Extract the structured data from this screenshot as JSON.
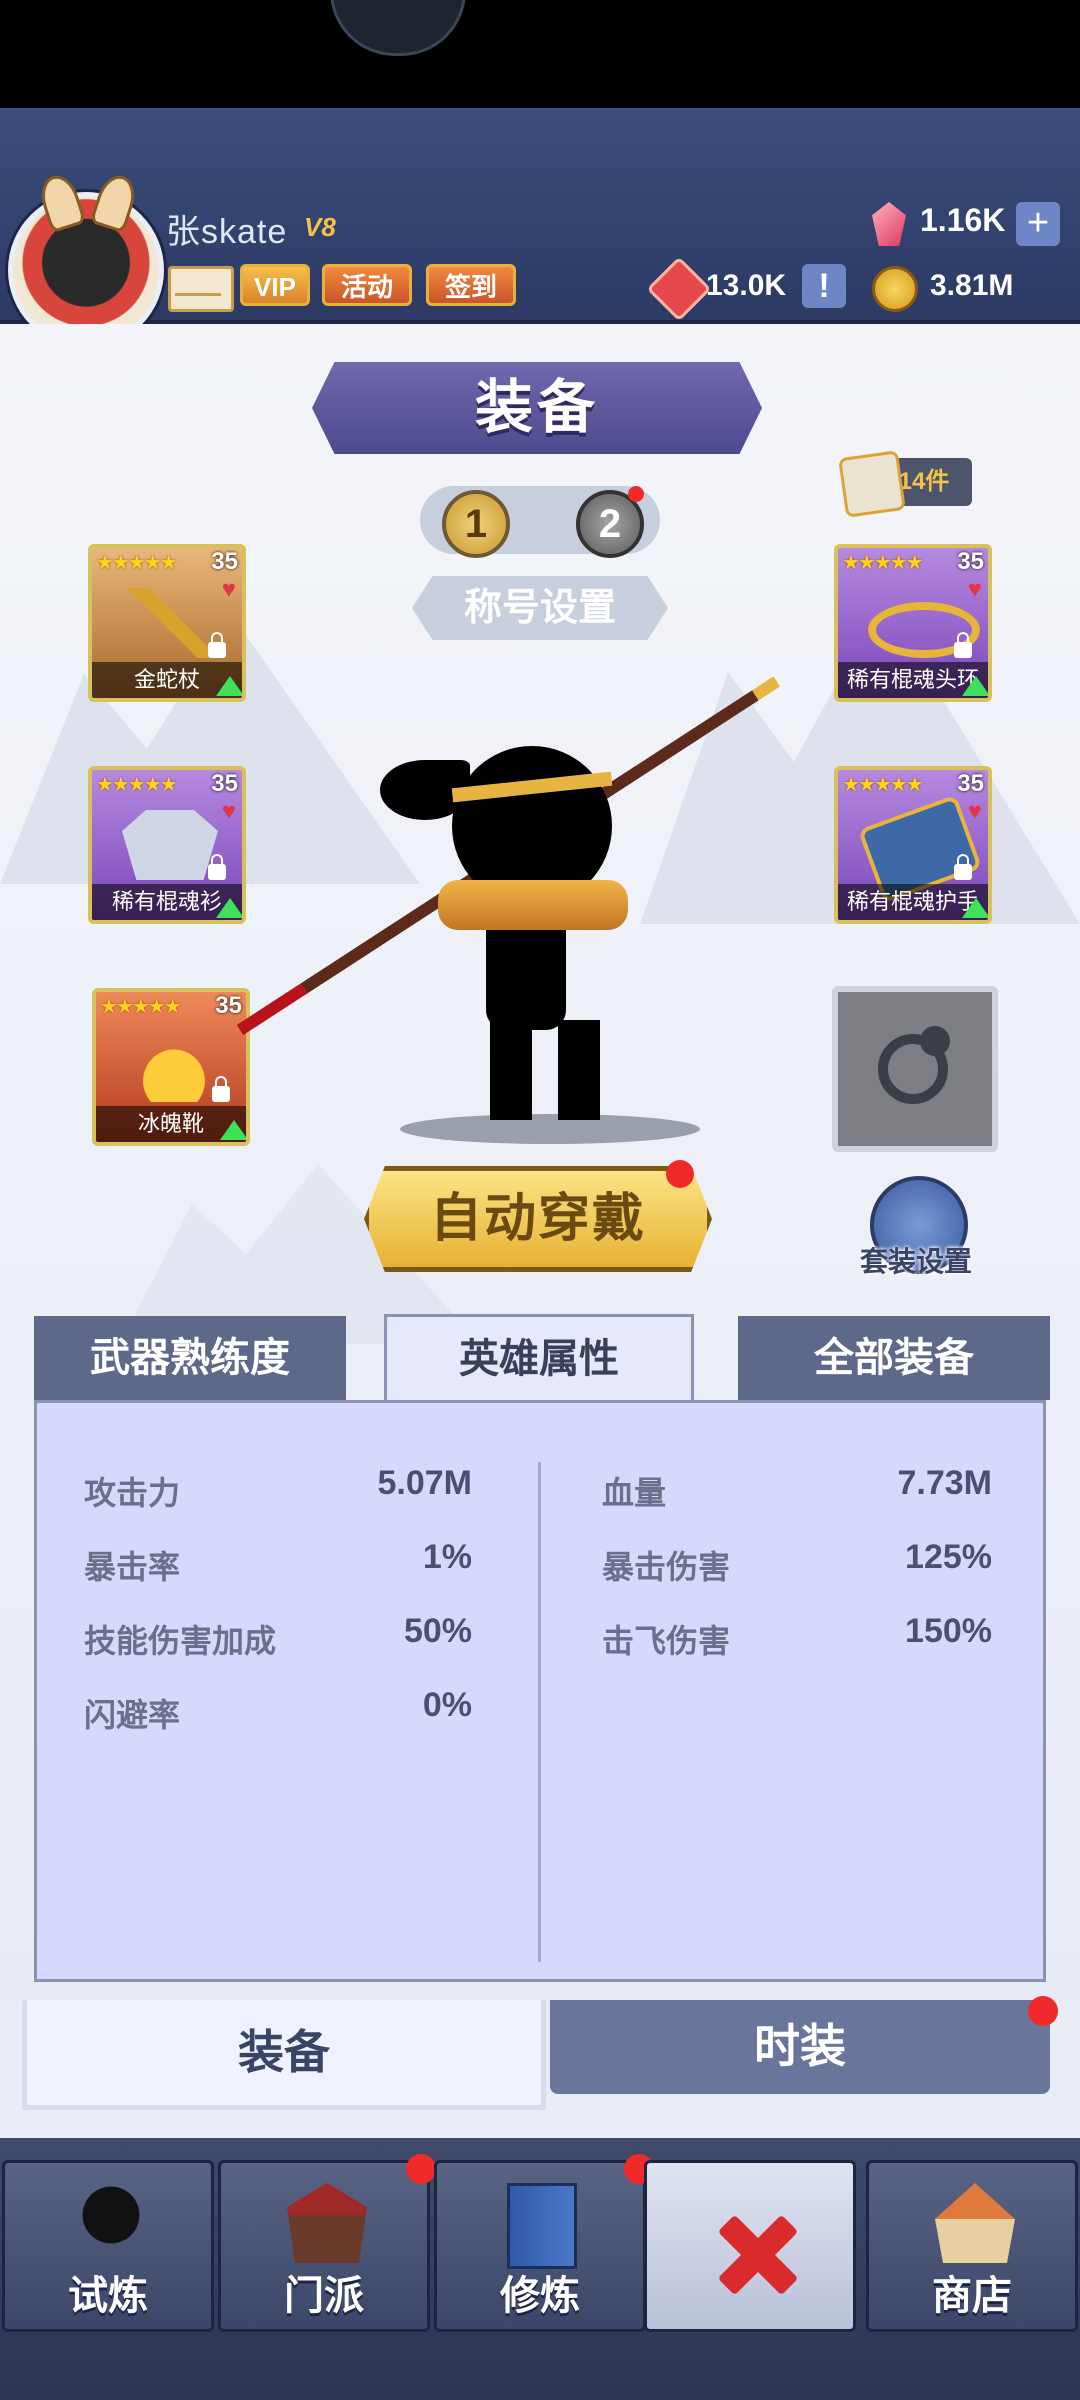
{
  "header": {
    "player_name": "张skate",
    "vip_level": "V8",
    "vip_label": "VIP",
    "event_label": "活动",
    "checkin_label": "签到",
    "gems": "1.16K",
    "gem_add": "+",
    "tickets": "13.0K",
    "ticket_info": "!",
    "coins": "3.81M"
  },
  "equipment": {
    "title": "装备",
    "loadouts": [
      "1",
      "2"
    ],
    "title_setting": "称号设置",
    "pieces_count": "14件",
    "slots": [
      {
        "name": "金蛇杖",
        "level": "35",
        "stars": "★★★★★",
        "icon": "golden-snake-staff"
      },
      {
        "name": "稀有棍魂衫",
        "level": "35",
        "stars": "★★★★★",
        "icon": "robe"
      },
      {
        "name": "冰魄靴",
        "level": "35",
        "stars": "★★★★★",
        "icon": "boots"
      },
      {
        "name": "稀有棍魂头环",
        "level": "35",
        "stars": "★★★★★",
        "icon": "headband"
      },
      {
        "name": "稀有棍魂护手",
        "level": "35",
        "stars": "★★★★★",
        "icon": "gauntlet"
      }
    ],
    "auto_equip": "自动穿戴",
    "suit_setting": "套装设置"
  },
  "tabs": [
    "武器熟练度",
    "英雄属性",
    "全部装备"
  ],
  "stats": {
    "left": [
      {
        "label": "攻击力",
        "value": "5.07M"
      },
      {
        "label": "暴击率",
        "value": "1%"
      },
      {
        "label": "技能伤害加成",
        "value": "50%"
      },
      {
        "label": "闪避率",
        "value": "0%"
      }
    ],
    "right": [
      {
        "label": "血量",
        "value": "7.73M"
      },
      {
        "label": "暴击伤害",
        "value": "125%"
      },
      {
        "label": "击飞伤害",
        "value": "150%"
      }
    ]
  },
  "bottom_tabs": {
    "equip": "装备",
    "fashion": "时装"
  },
  "nav": [
    "试炼",
    "门派",
    "修炼",
    "商店"
  ],
  "colors": {
    "accent_gold": "#e7b233",
    "header_blue": "#3c4d7c",
    "notify_red": "#f02a2a"
  }
}
